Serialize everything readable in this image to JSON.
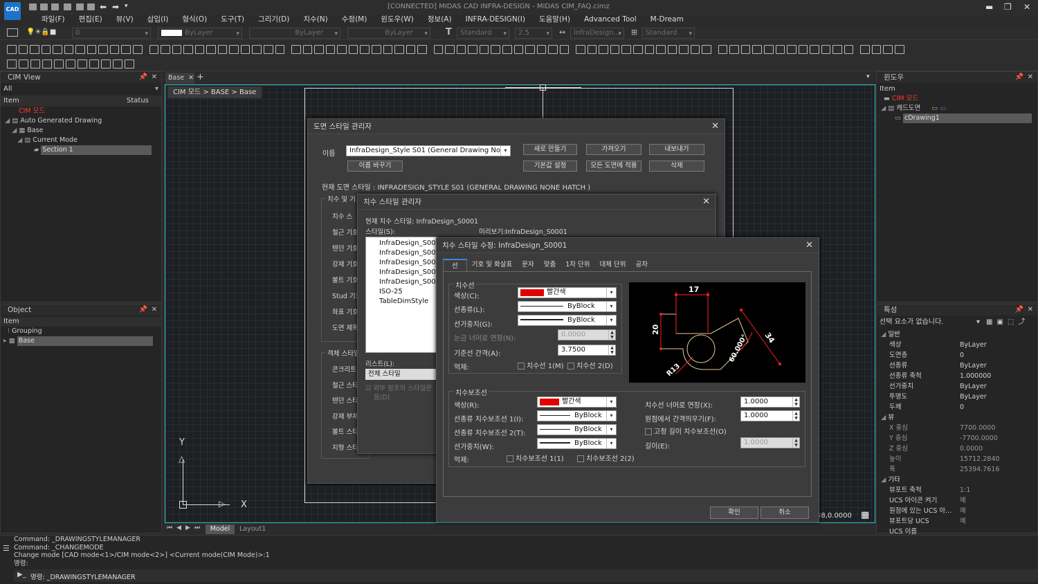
{
  "window": {
    "title": "[CONNECTED] MIDAS CAD INFRA-DESIGN - MIDAS CIM_FAQ.cimz",
    "logo": "CAD"
  },
  "menu": [
    "파일(F)",
    "편집(E)",
    "뷰(V)",
    "삽입(I)",
    "형식(O)",
    "도구(T)",
    "그리기(D)",
    "치수(N)",
    "수정(M)",
    "윈도우(W)",
    "정보(A)",
    "INFRA-DESIGN(I)",
    "도움말(H)",
    "Advanced Tool",
    "M-Dream"
  ],
  "toolbar": {
    "layer_value": "0",
    "color_value": "ByLayer",
    "linetype_value": "ByLayer",
    "lineweight_value": "ByLayer",
    "text_style": "Standard",
    "dim_scale": "2.5",
    "dim_style": "InfraDesign...",
    "table_style": "Standard"
  },
  "cim_view": {
    "title": "CIM View",
    "filter": "All",
    "col_item": "Item",
    "col_status": "Status",
    "tree": [
      "CIM 모드",
      "Auto Generated Drawing",
      "Base",
      "Current Mode",
      "Section 1"
    ]
  },
  "object_panel": {
    "title": "Object",
    "col_item": "Item",
    "tree": [
      "Grouping",
      "Base"
    ]
  },
  "window_panel": {
    "title": "윈도우",
    "col_item": "Item",
    "tree": [
      "CIM 모드",
      "캐드도면",
      "cDrawing1"
    ]
  },
  "doc": {
    "tab": "Base",
    "breadcrumb": "CIM 모드 > BASE > Base",
    "model_tab": "Model",
    "layout_tab": "Layout1",
    "coord": "58,0.0000",
    "ucs_y": "Y",
    "ucs_x": "X"
  },
  "props": {
    "title": "특성",
    "selection": "선택 요소가 없습니다.",
    "sec_general": "일반",
    "sec_view": "뷰",
    "sec_other": "기타",
    "general": [
      [
        "색상",
        "ByLayer"
      ],
      [
        "도면층",
        "0"
      ],
      [
        "선종류",
        "ByLayer"
      ],
      [
        "선종류 축척",
        "1.000000"
      ],
      [
        "선가중치",
        "ByLayer"
      ],
      [
        "투명도",
        "ByLayer"
      ],
      [
        "두께",
        "0"
      ]
    ],
    "view": [
      [
        "X 중심",
        "7700.0000"
      ],
      [
        "Y 중심",
        "-7700.0000"
      ],
      [
        "Z 중심",
        "0.0000"
      ],
      [
        "높이",
        "15712.2840"
      ],
      [
        "폭",
        "25394.7616"
      ]
    ],
    "other": [
      [
        "뷰포트 축척",
        "1:1"
      ],
      [
        "UCS 아이콘 켜기",
        "예"
      ],
      [
        "원점에 있는 UCS 아...",
        "예"
      ],
      [
        "뷰포트당 UCS",
        "예"
      ],
      [
        "UCS 이름",
        ""
      ]
    ]
  },
  "command": {
    "lines": [
      "Command:  _DRAWINGSTYLEMANAGER",
      "Command:  _CHANGEMODE",
      "Change mode [CAD mode<1>/CIM mode<2>] <Current mode(CIM Mode)>:1",
      "명령:"
    ],
    "prompt": "명령:  _DRAWINGSTYLEMANAGER"
  },
  "dsm": {
    "title": "도면 스타일 관리자",
    "name_label": "이름",
    "name_value": "InfraDesign_Style S01 (General Drawing None Ha",
    "btn_new": "새로 만들기",
    "btn_import": "가져오기",
    "btn_export": "내보내기",
    "btn_rename": "이름 바꾸기",
    "btn_default": "기본값 설정",
    "btn_apply_all": "모든 도면에 적용",
    "btn_delete": "삭제",
    "current": "현재 도면 스타일 : INFRADESIGN_STYLE S01 (GENERAL DRAWING NONE HATCH )",
    "group1": "치수 및 기",
    "left1": [
      "치수 스",
      "철근 기호",
      "텐던 기호",
      "강재 기호",
      "볼트 기호",
      "Stud 기호",
      "좌표 기호",
      "도면 제목"
    ],
    "group2": "객체 스타일",
    "left2": [
      "콘크리트",
      "철근 스타",
      "텐던 스타",
      "강재 부재",
      "볼트 스타일 스타일",
      "지형 스타일"
    ]
  },
  "dim_mgr": {
    "title": "치수 스타일 관리자",
    "current": "현재 치수 스타일: InfraDesign_S0001",
    "styles_label": "스타일(S):",
    "preview_label": "미리보기:InfraDesign_S0001",
    "styles": [
      "InfraDesign_S0001",
      "InfraDesign_S0002",
      "InfraDesign_S0003",
      "InfraDesign_S0004",
      "InfraDesign_S0005",
      "ISO-25",
      "TableDimStyle"
    ],
    "list_label": "리스트(L):",
    "list_value": "전체 스타일",
    "ext_ref": "외부 참조의 스타일은",
    "ext_ref2": "음(D)"
  },
  "dim_edit": {
    "title": "치수 스타일 수정: InfraDesign_S0001",
    "tabs": [
      "선",
      "기호 및 화살표",
      "문자",
      "맞춤",
      "1차 단위",
      "대체 단위",
      "공차"
    ],
    "dimline": {
      "title": "치수선",
      "color_label": "색상(C):",
      "color_value": "빨간색",
      "linetype_label": "선종류(L):",
      "linetype_value": "ByBlock",
      "weight_label": "선가중치(G):",
      "weight_value": "ByBlock",
      "tick_label": "눈금 너머로 연장(N):",
      "tick_value": "0.0000",
      "base_label": "기준선 간격(A):",
      "base_value": "3.7500",
      "suppress_label": "억제:",
      "sup1": "치수선 1(M)",
      "sup2": "치수선 2(D)"
    },
    "extline": {
      "title": "치수보조선",
      "color_label": "색상(R):",
      "color_value": "빨간색",
      "lt1_label": "선종류 치수보조선 1(I):",
      "lt1_value": "ByBlock",
      "lt2_label": "선종류 치수보조선 2(T):",
      "lt2_value": "ByBlock",
      "weight_label": "선가중치(W):",
      "weight_value": "ByBlock",
      "suppress_label": "억제:",
      "sup1": "치수보조선 1(1)",
      "sup2": "치수보조선 2(2)",
      "ext_label": "치수선 너머로 연장(X):",
      "ext_value": "1.0000",
      "offset_label": "원점에서 간격띄우기(F):",
      "offset_value": "1.0000",
      "fixed_label": "고정 길이 치수보조선(O)",
      "len_label": "길이(E):",
      "len_value": "1.0000"
    },
    "preview": {
      "d1": "17",
      "d2": "20",
      "d3": "34",
      "d4": "60.000°",
      "d5": "R13"
    },
    "ok": "확인",
    "cancel": "취소"
  }
}
